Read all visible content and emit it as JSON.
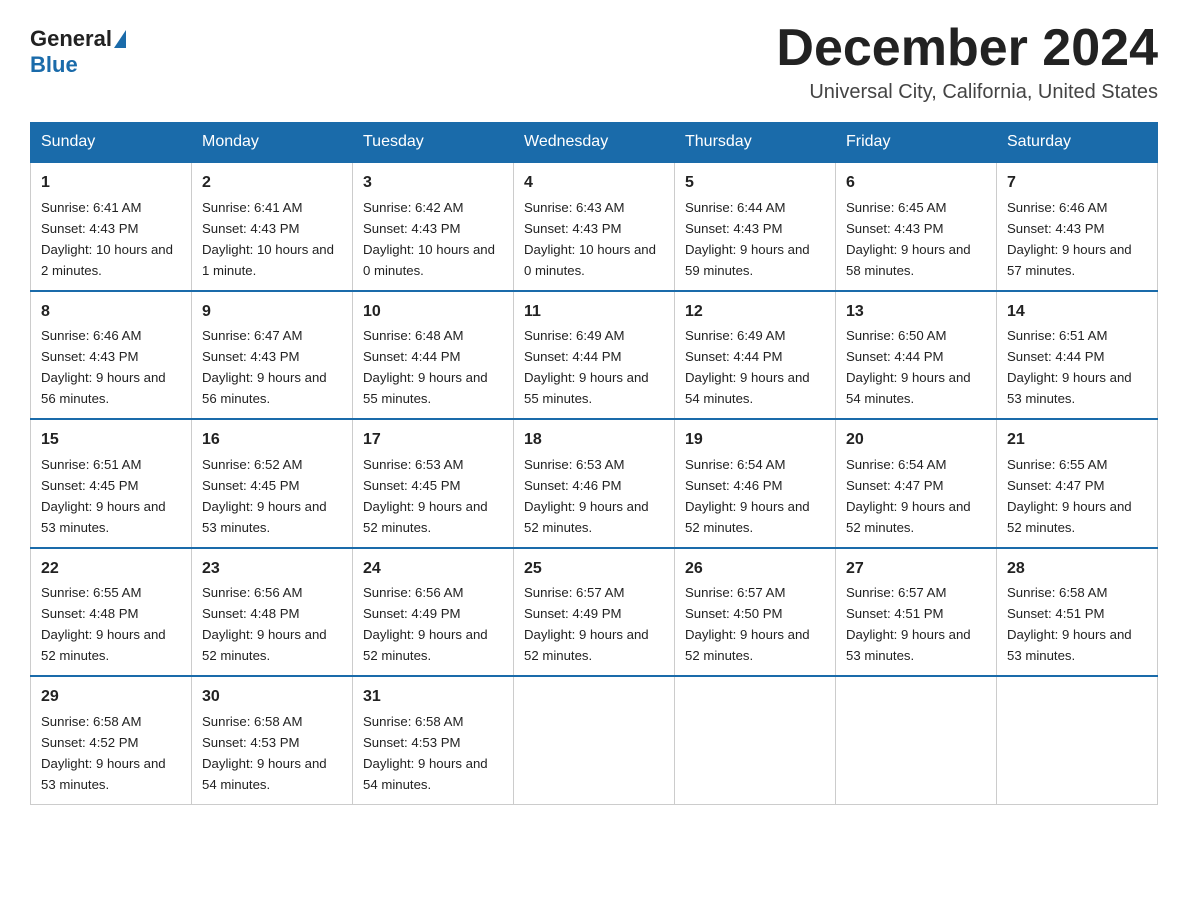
{
  "header": {
    "logo_general": "General",
    "logo_blue": "Blue",
    "month_title": "December 2024",
    "location": "Universal City, California, United States"
  },
  "days_of_week": [
    "Sunday",
    "Monday",
    "Tuesday",
    "Wednesday",
    "Thursday",
    "Friday",
    "Saturday"
  ],
  "weeks": [
    [
      {
        "day": "1",
        "sunrise": "6:41 AM",
        "sunset": "4:43 PM",
        "daylight": "10 hours and 2 minutes."
      },
      {
        "day": "2",
        "sunrise": "6:41 AM",
        "sunset": "4:43 PM",
        "daylight": "10 hours and 1 minute."
      },
      {
        "day": "3",
        "sunrise": "6:42 AM",
        "sunset": "4:43 PM",
        "daylight": "10 hours and 0 minutes."
      },
      {
        "day": "4",
        "sunrise": "6:43 AM",
        "sunset": "4:43 PM",
        "daylight": "10 hours and 0 minutes."
      },
      {
        "day": "5",
        "sunrise": "6:44 AM",
        "sunset": "4:43 PM",
        "daylight": "9 hours and 59 minutes."
      },
      {
        "day": "6",
        "sunrise": "6:45 AM",
        "sunset": "4:43 PM",
        "daylight": "9 hours and 58 minutes."
      },
      {
        "day": "7",
        "sunrise": "6:46 AM",
        "sunset": "4:43 PM",
        "daylight": "9 hours and 57 minutes."
      }
    ],
    [
      {
        "day": "8",
        "sunrise": "6:46 AM",
        "sunset": "4:43 PM",
        "daylight": "9 hours and 56 minutes."
      },
      {
        "day": "9",
        "sunrise": "6:47 AM",
        "sunset": "4:43 PM",
        "daylight": "9 hours and 56 minutes."
      },
      {
        "day": "10",
        "sunrise": "6:48 AM",
        "sunset": "4:44 PM",
        "daylight": "9 hours and 55 minutes."
      },
      {
        "day": "11",
        "sunrise": "6:49 AM",
        "sunset": "4:44 PM",
        "daylight": "9 hours and 55 minutes."
      },
      {
        "day": "12",
        "sunrise": "6:49 AM",
        "sunset": "4:44 PM",
        "daylight": "9 hours and 54 minutes."
      },
      {
        "day": "13",
        "sunrise": "6:50 AM",
        "sunset": "4:44 PM",
        "daylight": "9 hours and 54 minutes."
      },
      {
        "day": "14",
        "sunrise": "6:51 AM",
        "sunset": "4:44 PM",
        "daylight": "9 hours and 53 minutes."
      }
    ],
    [
      {
        "day": "15",
        "sunrise": "6:51 AM",
        "sunset": "4:45 PM",
        "daylight": "9 hours and 53 minutes."
      },
      {
        "day": "16",
        "sunrise": "6:52 AM",
        "sunset": "4:45 PM",
        "daylight": "9 hours and 53 minutes."
      },
      {
        "day": "17",
        "sunrise": "6:53 AM",
        "sunset": "4:45 PM",
        "daylight": "9 hours and 52 minutes."
      },
      {
        "day": "18",
        "sunrise": "6:53 AM",
        "sunset": "4:46 PM",
        "daylight": "9 hours and 52 minutes."
      },
      {
        "day": "19",
        "sunrise": "6:54 AM",
        "sunset": "4:46 PM",
        "daylight": "9 hours and 52 minutes."
      },
      {
        "day": "20",
        "sunrise": "6:54 AM",
        "sunset": "4:47 PM",
        "daylight": "9 hours and 52 minutes."
      },
      {
        "day": "21",
        "sunrise": "6:55 AM",
        "sunset": "4:47 PM",
        "daylight": "9 hours and 52 minutes."
      }
    ],
    [
      {
        "day": "22",
        "sunrise": "6:55 AM",
        "sunset": "4:48 PM",
        "daylight": "9 hours and 52 minutes."
      },
      {
        "day": "23",
        "sunrise": "6:56 AM",
        "sunset": "4:48 PM",
        "daylight": "9 hours and 52 minutes."
      },
      {
        "day": "24",
        "sunrise": "6:56 AM",
        "sunset": "4:49 PM",
        "daylight": "9 hours and 52 minutes."
      },
      {
        "day": "25",
        "sunrise": "6:57 AM",
        "sunset": "4:49 PM",
        "daylight": "9 hours and 52 minutes."
      },
      {
        "day": "26",
        "sunrise": "6:57 AM",
        "sunset": "4:50 PM",
        "daylight": "9 hours and 52 minutes."
      },
      {
        "day": "27",
        "sunrise": "6:57 AM",
        "sunset": "4:51 PM",
        "daylight": "9 hours and 53 minutes."
      },
      {
        "day": "28",
        "sunrise": "6:58 AM",
        "sunset": "4:51 PM",
        "daylight": "9 hours and 53 minutes."
      }
    ],
    [
      {
        "day": "29",
        "sunrise": "6:58 AM",
        "sunset": "4:52 PM",
        "daylight": "9 hours and 53 minutes."
      },
      {
        "day": "30",
        "sunrise": "6:58 AM",
        "sunset": "4:53 PM",
        "daylight": "9 hours and 54 minutes."
      },
      {
        "day": "31",
        "sunrise": "6:58 AM",
        "sunset": "4:53 PM",
        "daylight": "9 hours and 54 minutes."
      },
      null,
      null,
      null,
      null
    ]
  ],
  "labels": {
    "sunrise": "Sunrise:",
    "sunset": "Sunset:",
    "daylight": "Daylight:"
  }
}
